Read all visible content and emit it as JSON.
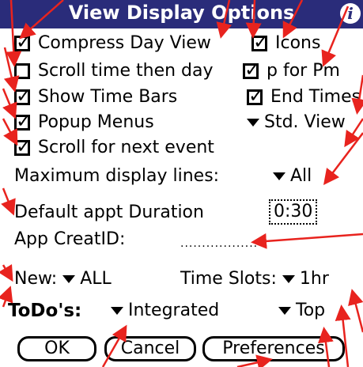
{
  "window": {
    "title": "View Display Options",
    "info_icon": "i"
  },
  "checkboxes_left": [
    {
      "label": "Compress Day View",
      "checked": true
    },
    {
      "label": "Scroll time then day",
      "checked": false
    },
    {
      "label": "Show Time Bars",
      "checked": true
    },
    {
      "label": "Popup Menus",
      "checked": true
    },
    {
      "label": "Scroll for next event",
      "checked": true
    }
  ],
  "checkboxes_right": [
    {
      "label": "Icons",
      "checked": true
    },
    {
      "label": "p for Pm",
      "checked": true
    },
    {
      "label": "End Times",
      "checked": true
    }
  ],
  "view_select": "Std. View",
  "max_lines": {
    "label": "Maximum display lines:",
    "value": "All"
  },
  "duration": {
    "label": "Default appt Duration",
    "value": "0:30"
  },
  "creat_id": {
    "label": "App CreatID:",
    "value": ""
  },
  "new_filter": {
    "label": "New:",
    "value": "ALL"
  },
  "time_slots": {
    "label": "Time Slots:",
    "value": "1hr"
  },
  "todos": {
    "label": "ToDo's:",
    "mode": "Integrated",
    "position": "Top"
  },
  "buttons": {
    "ok": "OK",
    "cancel": "Cancel",
    "preferences": "Preferences"
  },
  "colors": {
    "title_bg": "#2a2c7a",
    "annotation_arrow": "#e8231e"
  }
}
